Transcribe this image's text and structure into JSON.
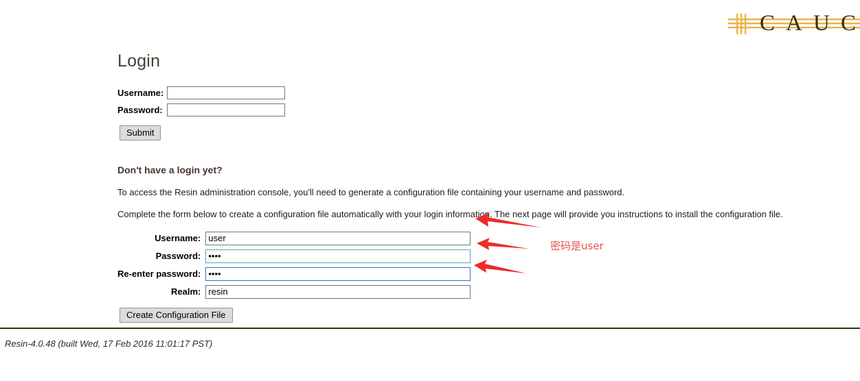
{
  "logo": {
    "text": "CAUC",
    "bar_color": "#e8b44a",
    "letter_color": "#3a2c12",
    "alt": "caucho-logo"
  },
  "page": {
    "title": "Login"
  },
  "login_form": {
    "fields": [
      {
        "label": "Username:",
        "value": "",
        "type": "text",
        "name": "username"
      },
      {
        "label": "Password:",
        "value": "",
        "type": "password",
        "name": "password"
      }
    ],
    "submit_label": "Submit"
  },
  "signup_section": {
    "heading": "Don't have a login yet?",
    "paragraph_1": "To access the Resin administration console, you'll need to generate a configuration file containing your username and password.",
    "paragraph_2": "Complete the form below to create a configuration file automatically with your login information. The next page will provide you instructions to install the configuration file."
  },
  "config_form": {
    "fields": [
      {
        "label": "Username:",
        "value": "user",
        "type": "text",
        "name": "config-username",
        "state": "normal"
      },
      {
        "label": "Password:",
        "value": "••••",
        "type": "password",
        "name": "config-password",
        "state": "focus-teal"
      },
      {
        "label": "Re-enter password:",
        "value": "••••",
        "type": "password",
        "name": "config-password-confirm",
        "state": "focus-blue"
      },
      {
        "label": "Realm:",
        "value": "resin",
        "type": "text",
        "name": "config-realm",
        "state": "normal"
      }
    ],
    "submit_label": "Create Configuration File"
  },
  "annotations": {
    "note": "密码是user",
    "note_color": "#e8524f",
    "arrow_color": "#ef2b2b",
    "arrow_count": 3
  },
  "footer": {
    "version_text": "Resin-4.0.48 (built Wed, 17 Feb 2016 11:01:17 PST)"
  }
}
